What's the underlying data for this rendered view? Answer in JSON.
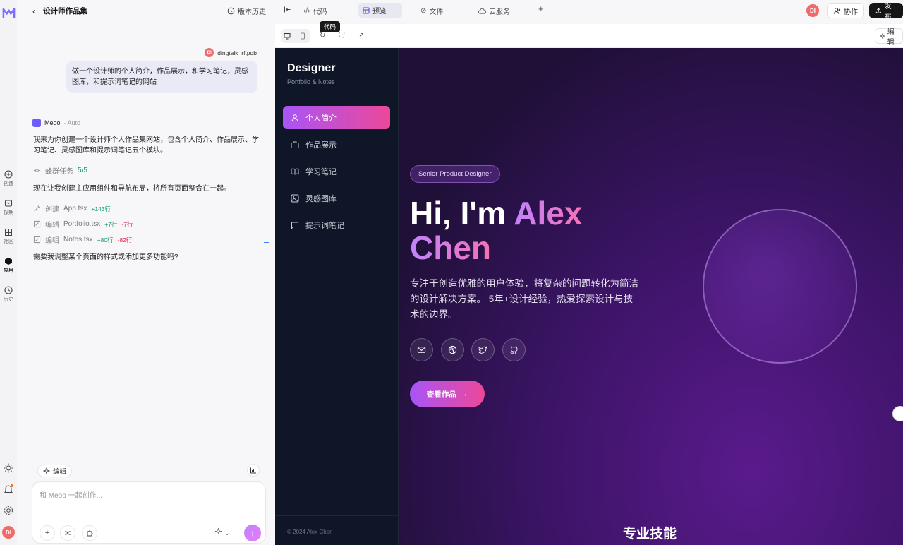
{
  "app": {
    "title": "设计师作品集",
    "version_history": "版本历史"
  },
  "rail": {
    "items": [
      {
        "label": "创造",
        "icon": "create-icon"
      },
      {
        "label": "探期",
        "icon": "explore-icon"
      },
      {
        "label": "社区",
        "icon": "community-icon"
      },
      {
        "label": "应用",
        "icon": "apps-icon"
      },
      {
        "label": "历史",
        "icon": "history-icon"
      }
    ],
    "avatar": "DI"
  },
  "chat": {
    "user": "dingtalk_rftpqb",
    "user_avatar": "DI",
    "user_message": "做一个设计师的个人简介，作品展示，和学习笔记，灵感图库，和提示词笔记的网站",
    "assistant_name": "Meoo",
    "assistant_mode": "· Auto",
    "reply_1": "我来为你创建一个设计师个人作品集网站，包含个人简介、作品展示、学习笔记、灵感图库和提示词笔记五个模块。",
    "task_label": "蜂群任务",
    "task_count": "5/5",
    "reply_2": "现在让我创建主应用组件和导航布局，将所有页面整合在一起。",
    "tools": [
      {
        "action": "创建",
        "file": "App.tsx",
        "add": "+143行",
        "del": ""
      },
      {
        "action": "编辑",
        "file": "Portfolio.tsx",
        "add": "+7行",
        "del": "-7行"
      },
      {
        "action": "编辑",
        "file": "Notes.tsx",
        "add": "+80行",
        "del": "-82行"
      }
    ],
    "reply_3": "需要我调整某个页面的样式或添加更多功能吗?",
    "edit_chip": "编辑",
    "input_placeholder": "和 Meoo 一起创作..."
  },
  "topbar": {
    "tabs": [
      {
        "label": "代码",
        "icon": "code-icon"
      },
      {
        "label": "预览",
        "icon": "preview-icon"
      },
      {
        "label": "文件",
        "icon": "file-icon"
      },
      {
        "label": "云服务",
        "icon": "cloud-icon"
      }
    ],
    "active_tab": "预览",
    "collab": "协作",
    "publish": "发布",
    "avatar": "DI"
  },
  "preview_toolbar": {
    "tooltip": "代码",
    "edit": "编辑"
  },
  "site": {
    "brand": "Designer",
    "brand_sub": "Portfolio & Notes",
    "nav": [
      "个人简介",
      "作品展示",
      "学习笔记",
      "灵感图库",
      "提示词笔记"
    ],
    "nav_active": "个人简介",
    "copyright": "© 2024 Alex Chen",
    "badge": "Senior Product Designer",
    "hero_prefix": "Hi, I'm ",
    "hero_name_1": "Alex",
    "hero_name_2": "Chen",
    "description": "专注于创造优雅的用户体验，将复杂的问题转化为简洁的设计解决方案。 5年+设计经验，热爱探索设计与技术的边界。",
    "socials": [
      "mail-icon",
      "dribbble-icon",
      "twitter-icon",
      "github-icon"
    ],
    "cta": "查看作品",
    "skills_heading": "专业技能"
  }
}
